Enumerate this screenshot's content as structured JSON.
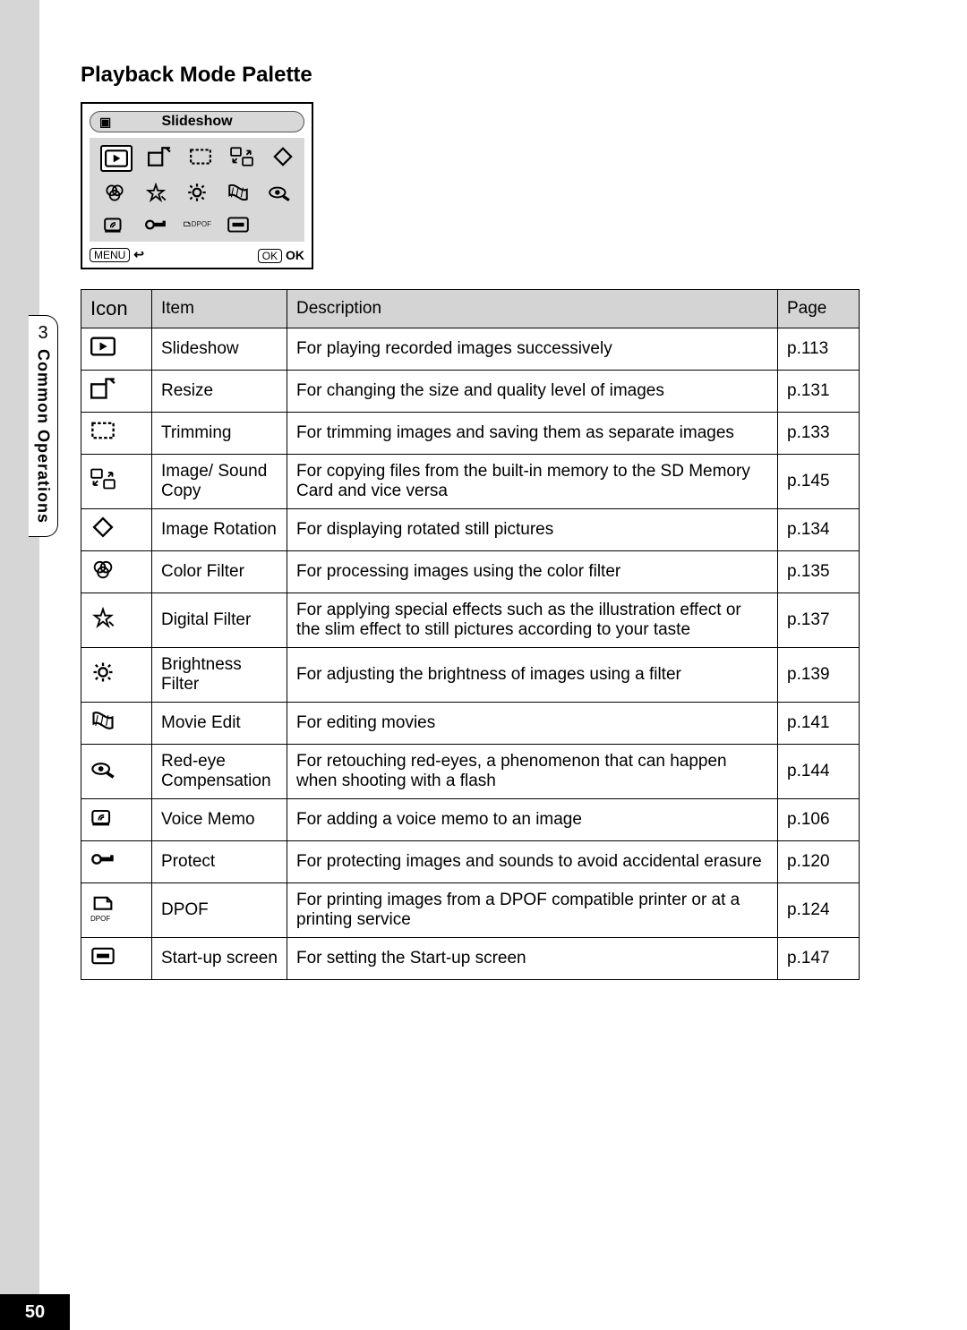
{
  "page_number": "50",
  "chapter_number": "3",
  "section_label": "Common Operations",
  "heading": "Playback Mode Palette",
  "palette": {
    "header_label": "Slideshow",
    "footer_left": "MENU",
    "footer_ok_btn": "OK",
    "footer_ok_label": "OK"
  },
  "table": {
    "headers": {
      "icon": "Icon",
      "item": "Item",
      "description": "Description",
      "page": "Page"
    },
    "rows": [
      {
        "icon": "slideshow",
        "item": "Slideshow",
        "description": "For playing recorded images successively",
        "page": "p.113"
      },
      {
        "icon": "resize",
        "item": "Resize",
        "description": "For changing the size and quality level of images",
        "page": "p.131"
      },
      {
        "icon": "trimming",
        "item": "Trimming",
        "description": "For trimming images and saving them as separate images",
        "page": "p.133"
      },
      {
        "icon": "copy",
        "item": "Image/ Sound Copy",
        "description": "For copying files from the built-in memory to the SD Memory Card and vice versa",
        "page": "p.145"
      },
      {
        "icon": "rotation",
        "item": "Image Rotation",
        "description": "For displaying rotated still pictures",
        "page": "p.134"
      },
      {
        "icon": "colorfilter",
        "item": "Color Filter",
        "description": "For processing images using the color filter",
        "page": "p.135"
      },
      {
        "icon": "digfilter",
        "item": "Digital Filter",
        "description": "For applying special effects such as the illustration effect or the slim effect to still pictures according to your taste",
        "page": "p.137"
      },
      {
        "icon": "brightness",
        "item": "Brightness Filter",
        "description": "For adjusting the brightness of images using a filter",
        "page": "p.139"
      },
      {
        "icon": "movieedit",
        "item": "Movie Edit",
        "description": "For editing movies",
        "page": "p.141"
      },
      {
        "icon": "redeye",
        "item": "Red-eye Compensation",
        "description": "For retouching red-eyes, a phenomenon that can happen when shooting with a flash",
        "page": "p.144"
      },
      {
        "icon": "voicememo",
        "item": "Voice Memo",
        "description": "For adding a voice memo to an image",
        "page": "p.106"
      },
      {
        "icon": "protect",
        "item": "Protect",
        "description": "For protecting images and sounds to avoid accidental erasure",
        "page": "p.120"
      },
      {
        "icon": "dpof",
        "item": "DPOF",
        "description": "For printing images from a DPOF compatible printer or at a printing service",
        "page": "p.124"
      },
      {
        "icon": "startup",
        "item": "Start-up screen",
        "description": "For setting the Start-up screen",
        "page": "p.147"
      }
    ]
  }
}
